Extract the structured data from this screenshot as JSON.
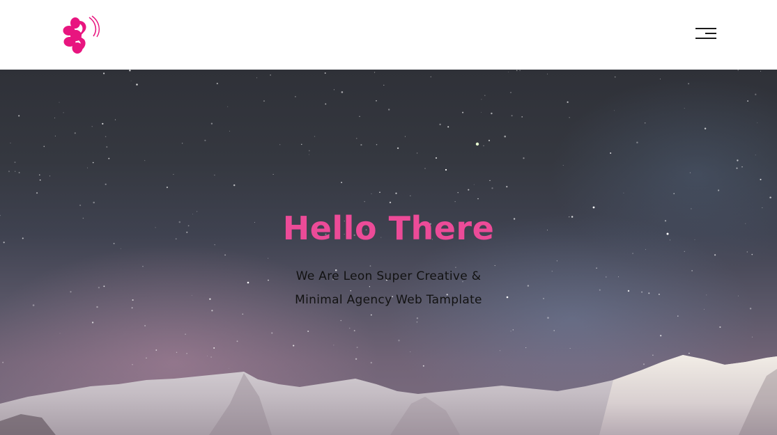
{
  "header": {
    "logo_icon": "flower-face-logo",
    "menu_icon": "hamburger-menu-icon"
  },
  "hero": {
    "title": "Hello There",
    "subtitle_line1": "We Are Leon Super Creative &",
    "subtitle_line2": "Minimal Agency Web Tamplate",
    "background": "starry-night-snowy-mountains"
  },
  "colors": {
    "accent": "#ec4b98",
    "logo": "#e8157f",
    "header_bg": "#ffffff",
    "text_dark": "#121212"
  }
}
